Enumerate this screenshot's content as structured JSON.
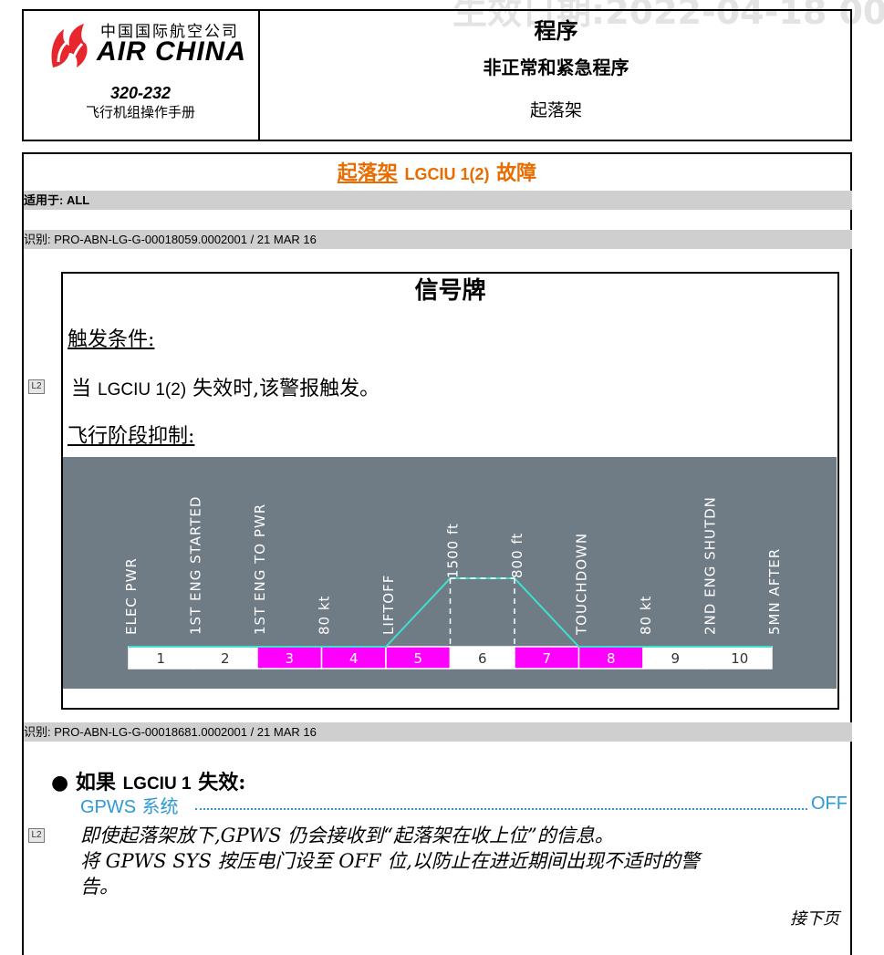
{
  "watermark": "生效日期:2022-04-18 00",
  "header": {
    "airline_cn": "中国国际航空公司",
    "airline_en": "AIR CHINA",
    "aircraft_model": "320-232",
    "manual_name": "飞行机组操作手册",
    "title": "程序",
    "subtitle": "非正常和紧急程序",
    "section": "起落架"
  },
  "procedure": {
    "title_underlined": "起落架",
    "title_en": "LGCIU 1(2)",
    "title_tail": "故障",
    "applicability_label": "适用于",
    "applicability_value": ": ALL",
    "ident_label": "识别",
    "ident_1": ": PRO-ABN-LG-G-00018059.0002001 / 21 MAR 16",
    "ident_2": ": PRO-ABN-LG-G-00018681.0002001 / 21 MAR 16",
    "level_tag": "L2"
  },
  "warning": {
    "heading": "信号牌",
    "trigger_label": "触发条件:",
    "trigger_text_prefix": "当",
    "trigger_text_en": "LGCIU 1(2)",
    "trigger_text_suffix": "失效时,该警报触发。",
    "phase_inhibit_label": "飞行阶段抑制:"
  },
  "phase_chart": {
    "events": [
      {
        "label": "ELEC PWR"
      },
      {
        "label": "1ST ENG STARTED"
      },
      {
        "label": "1ST ENG TO PWR"
      },
      {
        "label": "80 kt"
      },
      {
        "label": "LIFTOFF"
      },
      {
        "label": "1500 ft"
      },
      {
        "label": "800 ft"
      },
      {
        "label": "TOUCHDOWN"
      },
      {
        "label": "80 kt"
      },
      {
        "label": "2ND ENG SHUTDN"
      },
      {
        "label": "5MN AFTER"
      }
    ],
    "phases": [
      {
        "label": "1",
        "inhibited": false
      },
      {
        "label": "2",
        "inhibited": false
      },
      {
        "label": "3",
        "inhibited": true
      },
      {
        "label": "4",
        "inhibited": true
      },
      {
        "label": "5",
        "inhibited": true
      },
      {
        "label": "6",
        "inhibited": false
      },
      {
        "label": "7",
        "inhibited": true
      },
      {
        "label": "8",
        "inhibited": true
      },
      {
        "label": "9",
        "inhibited": false
      },
      {
        "label": "10",
        "inhibited": false
      }
    ],
    "colors": {
      "background": "#6f7b85",
      "inhibited": "#ff00ff",
      "normal": "#ffffff",
      "profile": "#40e0d0",
      "text": "#ffffff"
    }
  },
  "action": {
    "condition_prefix": "如果",
    "condition_en": "LGCIU 1",
    "condition_suffix": "失效:",
    "item_en": "GPWS",
    "item_cn": "系统",
    "item_value": "OFF",
    "note_line1": "即使起落架放下,GPWS 仍会接收到“起落架在收上位”的信息。",
    "note_line2": "将 GPWS SYS 按压电门设至 OFF 位,以防止在进近期间出现不适时的警",
    "note_line3": "告。",
    "continue_label": "接下页"
  }
}
